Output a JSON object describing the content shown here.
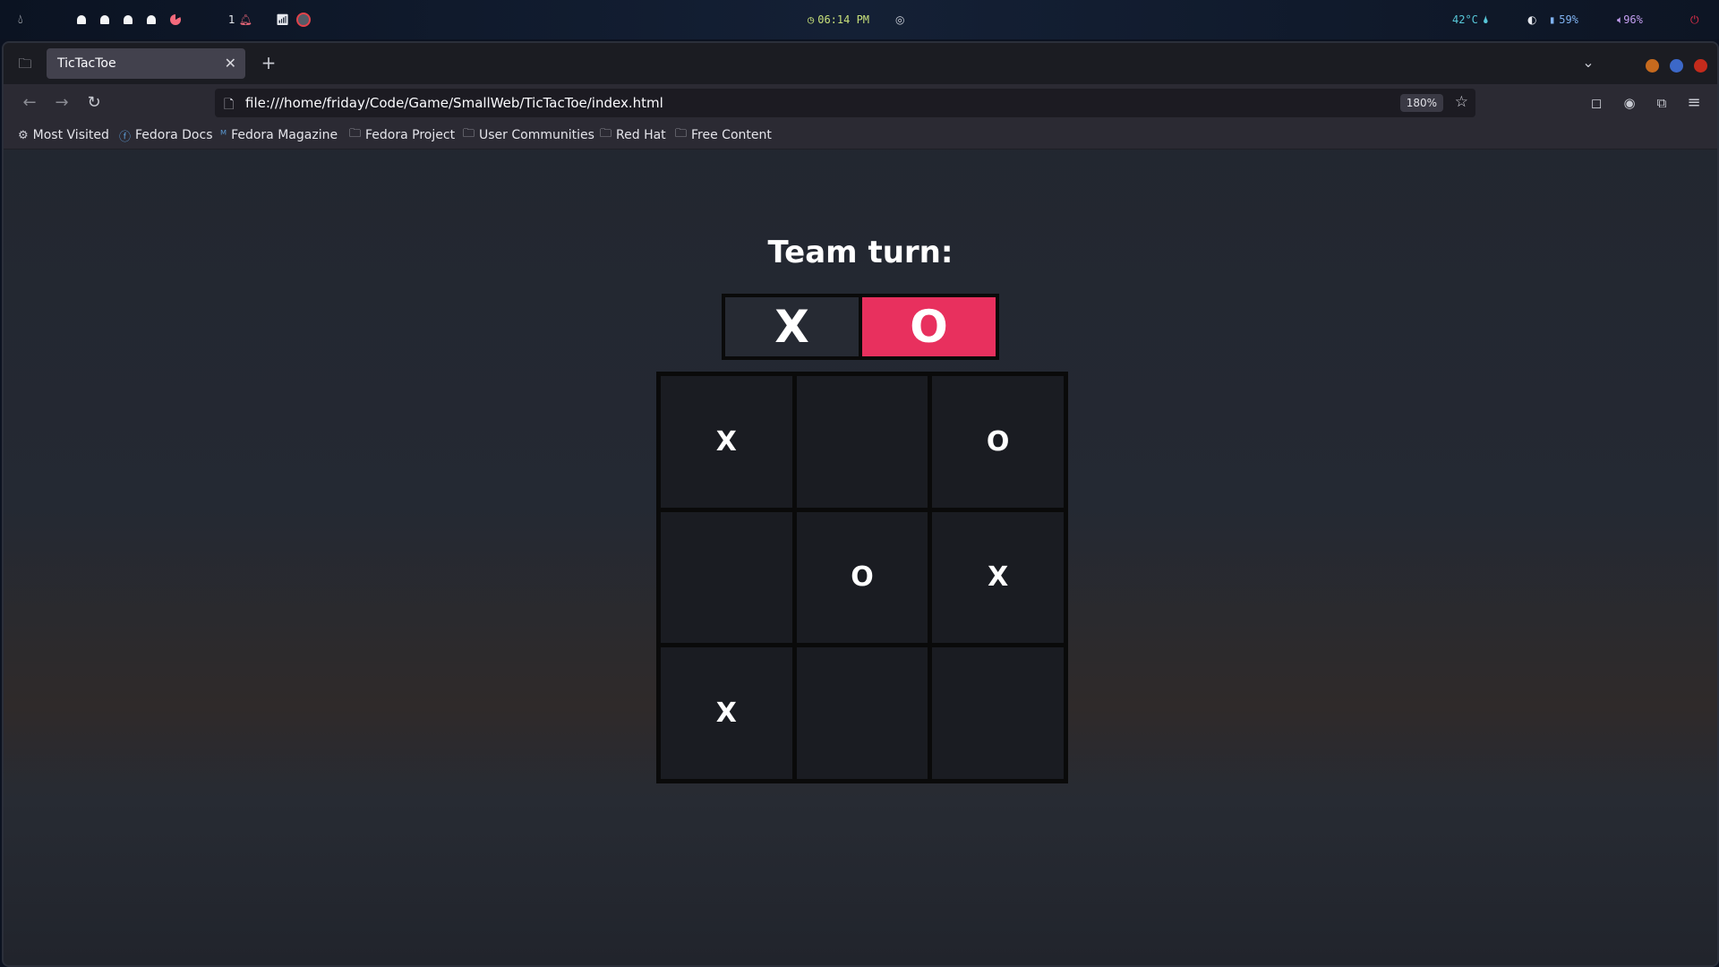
{
  "topbar": {
    "launcher_icon": "droplet-icon",
    "notification_count": "1",
    "clock": "06:14 PM",
    "temperature": "42°C",
    "battery": "59%",
    "volume": "96%"
  },
  "browser": {
    "tab_title": "TicTacToe",
    "url": "file:///home/friday/Code/Game/SmallWeb/TicTacToe/index.html",
    "zoom": "180%",
    "bookmarks": [
      "Most Visited",
      "Fedora Docs",
      "Fedora Magazine",
      "Fedora Project",
      "User Communities",
      "Red Hat",
      "Free Content"
    ]
  },
  "game": {
    "turn_label": "Team turn:",
    "teams": [
      "X",
      "O"
    ],
    "active_team": "O",
    "board": [
      "X",
      "",
      "O",
      "",
      "O",
      "X",
      "X",
      "",
      ""
    ]
  },
  "colors": {
    "accent": "#e8305e",
    "window_close": "#c42b1c",
    "window_max": "#3c68c8",
    "window_min": "#c66a1e"
  }
}
